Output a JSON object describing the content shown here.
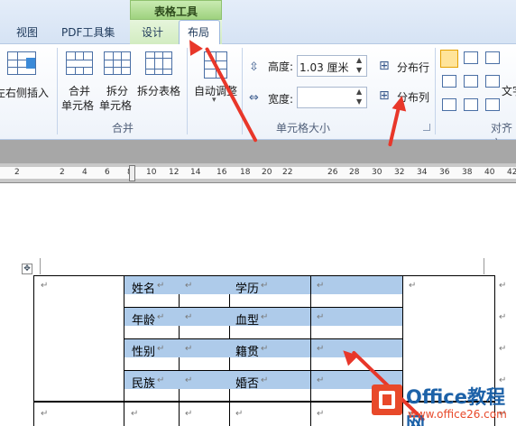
{
  "ribbon": {
    "context_group": "表格工具",
    "tabs": [
      "视图",
      "PDF工具集",
      "设计",
      "布局"
    ],
    "active_tab": "布局",
    "buttons": {
      "insert_right": "左右侧插入",
      "merge_cells_1": "合并",
      "merge_cells_2": "单元格",
      "split_cells_1": "拆分",
      "split_cells_2": "单元格",
      "split_table": "拆分表格",
      "autofit": "自动调整",
      "distribute_rows": "分布行",
      "distribute_columns": "分布列",
      "text_dir": "文字"
    },
    "height_label": "高度:",
    "height_value": "1.03 厘米",
    "width_label": "宽度:",
    "width_value": "",
    "groups": {
      "merge": "合并",
      "cell_size": "单元格大小",
      "alignment": "对齐方"
    }
  },
  "ruler": {
    "numbers": [
      "2",
      "2",
      "4",
      "6",
      "8",
      "10",
      "12",
      "14",
      "16",
      "18",
      "20",
      "22",
      "26",
      "28",
      "30",
      "32",
      "34",
      "36",
      "38",
      "40",
      "42"
    ]
  },
  "table": {
    "labels": [
      "姓名",
      "学历",
      "年龄",
      "血型",
      "性别",
      "籍贯",
      "民族",
      "婚否"
    ],
    "para_mark": "↵"
  },
  "watermark": {
    "title": "Office教程网",
    "url": "www.office26.com"
  },
  "colors": {
    "arrow": "#e8372a",
    "cell_highlight": "#aecbea",
    "context_tab": "#9fd27f"
  }
}
